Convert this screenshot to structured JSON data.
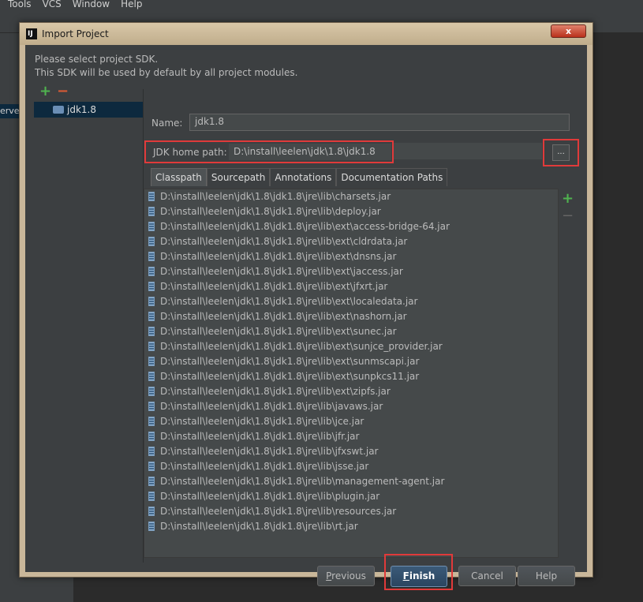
{
  "ide": {
    "menu": [
      "Tools",
      "VCS",
      "Window",
      "Help"
    ],
    "left_fragment": "erve"
  },
  "dialog": {
    "title": "Import Project",
    "close_symbol": "x",
    "intro_line1": "Please select project SDK.",
    "intro_line2": "This SDK will be used by default by all project modules.",
    "sdk_list": [
      "jdk1.8"
    ],
    "name_label": "Name:",
    "name_value": "jdk1.8",
    "jdk_label": "JDK home path:",
    "jdk_value": "D:\\install\\leelen\\jdk\\1.8\\jdk1.8",
    "browse_label": "...",
    "tabs": [
      "Classpath",
      "Sourcepath",
      "Annotations",
      "Documentation Paths"
    ],
    "active_tab": "Classpath",
    "classpath": [
      "D:\\install\\leelen\\jdk\\1.8\\jdk1.8\\jre\\lib\\charsets.jar",
      "D:\\install\\leelen\\jdk\\1.8\\jdk1.8\\jre\\lib\\deploy.jar",
      "D:\\install\\leelen\\jdk\\1.8\\jdk1.8\\jre\\lib\\ext\\access-bridge-64.jar",
      "D:\\install\\leelen\\jdk\\1.8\\jdk1.8\\jre\\lib\\ext\\cldrdata.jar",
      "D:\\install\\leelen\\jdk\\1.8\\jdk1.8\\jre\\lib\\ext\\dnsns.jar",
      "D:\\install\\leelen\\jdk\\1.8\\jdk1.8\\jre\\lib\\ext\\jaccess.jar",
      "D:\\install\\leelen\\jdk\\1.8\\jdk1.8\\jre\\lib\\ext\\jfxrt.jar",
      "D:\\install\\leelen\\jdk\\1.8\\jdk1.8\\jre\\lib\\ext\\localedata.jar",
      "D:\\install\\leelen\\jdk\\1.8\\jdk1.8\\jre\\lib\\ext\\nashorn.jar",
      "D:\\install\\leelen\\jdk\\1.8\\jdk1.8\\jre\\lib\\ext\\sunec.jar",
      "D:\\install\\leelen\\jdk\\1.8\\jdk1.8\\jre\\lib\\ext\\sunjce_provider.jar",
      "D:\\install\\leelen\\jdk\\1.8\\jdk1.8\\jre\\lib\\ext\\sunmscapi.jar",
      "D:\\install\\leelen\\jdk\\1.8\\jdk1.8\\jre\\lib\\ext\\sunpkcs11.jar",
      "D:\\install\\leelen\\jdk\\1.8\\jdk1.8\\jre\\lib\\ext\\zipfs.jar",
      "D:\\install\\leelen\\jdk\\1.8\\jdk1.8\\jre\\lib\\javaws.jar",
      "D:\\install\\leelen\\jdk\\1.8\\jdk1.8\\jre\\lib\\jce.jar",
      "D:\\install\\leelen\\jdk\\1.8\\jdk1.8\\jre\\lib\\jfr.jar",
      "D:\\install\\leelen\\jdk\\1.8\\jdk1.8\\jre\\lib\\jfxswt.jar",
      "D:\\install\\leelen\\jdk\\1.8\\jdk1.8\\jre\\lib\\jsse.jar",
      "D:\\install\\leelen\\jdk\\1.8\\jdk1.8\\jre\\lib\\management-agent.jar",
      "D:\\install\\leelen\\jdk\\1.8\\jdk1.8\\jre\\lib\\plugin.jar",
      "D:\\install\\leelen\\jdk\\1.8\\jdk1.8\\jre\\lib\\resources.jar",
      "D:\\install\\leelen\\jdk\\1.8\\jdk1.8\\jre\\lib\\rt.jar"
    ],
    "buttons": {
      "previous": "Previous",
      "finish": "Finish",
      "cancel": "Cancel",
      "help": "Help"
    },
    "icons": {
      "add": "+",
      "remove": "−"
    },
    "colors": {
      "highlight_box": "#e03a3a",
      "add_icon": "#4fb34f",
      "remove_icon": "#d95a35",
      "selection": "#0d293e"
    }
  }
}
